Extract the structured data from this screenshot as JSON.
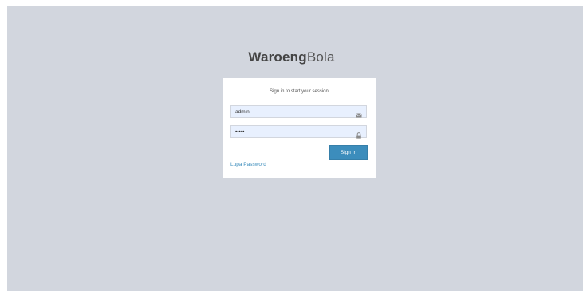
{
  "logo": {
    "bold": "Waroeng",
    "light": "Bola"
  },
  "login": {
    "message": "Sign in to start your session",
    "email": {
      "value": "admin",
      "icon": "envelope-icon"
    },
    "password": {
      "value": "•••••",
      "icon": "lock-icon"
    },
    "signin_label": "Sign In",
    "forgot_label": "Lupa Password"
  },
  "colors": {
    "background": "#d2d6de",
    "primary": "#3c8dbc",
    "autofill": "#e8f0fe"
  }
}
